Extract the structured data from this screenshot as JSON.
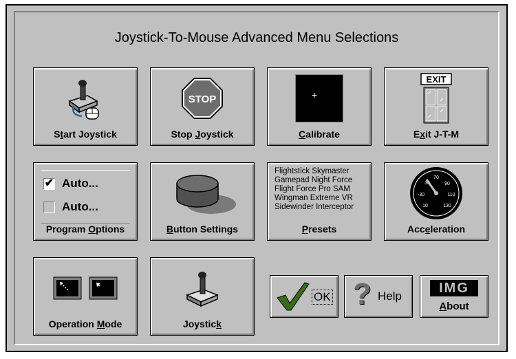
{
  "dialog": {
    "title": "Joystick-To-Mouse Advanced Menu Selections"
  },
  "tiles": {
    "start": {
      "pre": "S",
      "ul": "t",
      "post": "art Joystick"
    },
    "stop": {
      "pre": "Stop ",
      "ul": "J",
      "post": "oystick",
      "sign": "STOP"
    },
    "calibrate": {
      "pre": "",
      "ul": "C",
      "post": "alibrate",
      "crosshair": "+"
    },
    "exit": {
      "pre": "E",
      "ul": "x",
      "post": "it J-T-M",
      "sign": "EXIT"
    },
    "program_options": {
      "pre": "Program ",
      "ul": "O",
      "post": "ptions",
      "options": [
        {
          "label": "Auto...",
          "checked": true,
          "mark": "✔"
        },
        {
          "label": "Auto...",
          "checked": false,
          "mark": ""
        }
      ]
    },
    "button_settings": {
      "pre": "",
      "ul": "B",
      "post": "utton Settings"
    },
    "presets": {
      "pre": "",
      "ul": "P",
      "post": "resets",
      "list": [
        "Flightstick Skymaster",
        "Gamepad Night Force",
        "Flight Force Pro SAM",
        "Wingman Extreme VR",
        "Sidewinder Interceptor"
      ]
    },
    "acceleration": {
      "pre": "Acc",
      "ul": "e",
      "post": "leration",
      "gauge_labels": [
        "30",
        "50",
        "70",
        "90",
        "110",
        "130",
        "10",
        "-30"
      ]
    },
    "operation_mode": {
      "pre": "Operation ",
      "ul": "M",
      "post": "ode"
    },
    "joystick": {
      "pre": "Joystic",
      "ul": "k",
      "post": ""
    }
  },
  "buttons": {
    "ok": "OK",
    "help": "Help",
    "about_pre": "",
    "about_ul": "A",
    "about_post": "bout",
    "about_logo": "IMG"
  },
  "colors": {
    "face": "#c0c0c0",
    "shadow": "#808080",
    "highlight": "#ffffff",
    "check": "#3a6b1a",
    "help": "#6d6d6d"
  }
}
